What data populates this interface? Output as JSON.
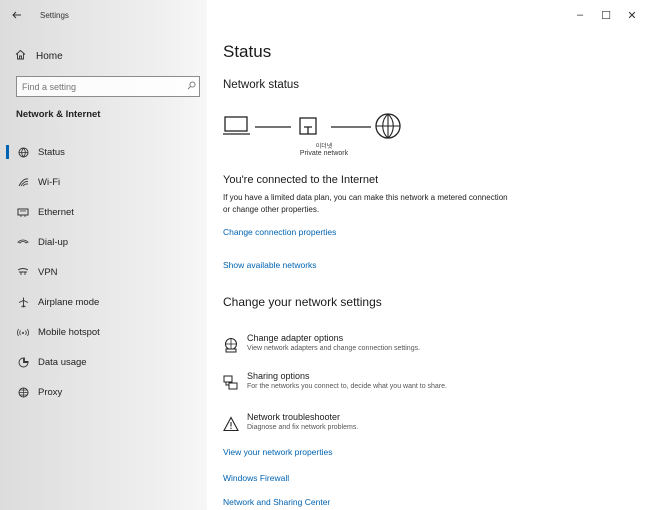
{
  "window": {
    "title": "Settings",
    "controls": {
      "minimize": "–",
      "maximize": "☐",
      "close": "✕"
    }
  },
  "sidebar": {
    "back_icon": "arrow-left-icon",
    "home_label": "Home",
    "search_placeholder": "Find a setting",
    "section_title": "Network & Internet",
    "items": [
      {
        "label": "Status",
        "icon": "status-globe-icon",
        "active": true
      },
      {
        "label": "Wi-Fi",
        "icon": "wifi-icon",
        "active": false
      },
      {
        "label": "Ethernet",
        "icon": "ethernet-icon",
        "active": false
      },
      {
        "label": "Dial-up",
        "icon": "dialup-icon",
        "active": false
      },
      {
        "label": "VPN",
        "icon": "vpn-icon",
        "active": false
      },
      {
        "label": "Airplane mode",
        "icon": "airplane-icon",
        "active": false
      },
      {
        "label": "Mobile hotspot",
        "icon": "hotspot-icon",
        "active": false
      },
      {
        "label": "Data usage",
        "icon": "data-usage-icon",
        "active": false
      },
      {
        "label": "Proxy",
        "icon": "globe-icon",
        "active": false
      }
    ]
  },
  "main": {
    "page_title": "Status",
    "network_status_heading": "Network status",
    "diagram": {
      "network_name": "이더넷",
      "network_type": "Private network"
    },
    "connected_title": "You're connected to the Internet",
    "connected_desc": "If you have a limited data plan, you can make this network a metered connection or change other properties.",
    "link_change_properties": "Change connection properties",
    "link_show_networks": "Show available networks",
    "change_settings_heading": "Change your network settings",
    "options": [
      {
        "title": "Change adapter options",
        "desc": "View network adapters and change connection settings.",
        "icon": "adapter-icon"
      },
      {
        "title": "Sharing options",
        "desc": "For the networks you connect to, decide what you want to share.",
        "icon": "sharing-icon"
      },
      {
        "title": "Network troubleshooter",
        "desc": "Diagnose and fix network problems.",
        "icon": "warning-icon"
      }
    ],
    "link_view_properties": "View your network properties",
    "link_firewall": "Windows Firewall",
    "link_sharing_center": "Network and Sharing Center"
  },
  "colors": {
    "accent": "#0063b1"
  }
}
